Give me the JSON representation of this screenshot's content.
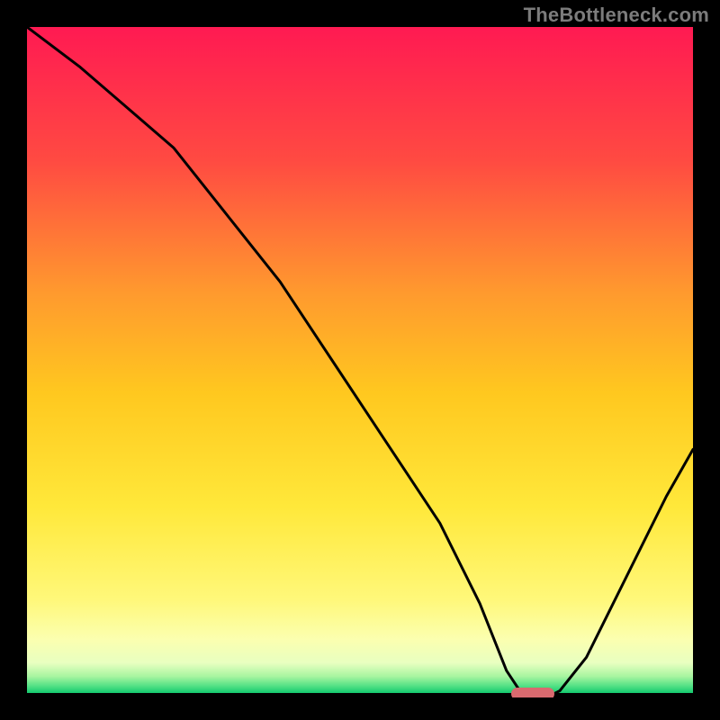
{
  "watermark": "TheBottleneck.com",
  "chart_data": {
    "type": "line",
    "title": "",
    "xlabel": "",
    "ylabel": "",
    "xlim": [
      0,
      100
    ],
    "ylim": [
      0,
      100
    ],
    "series": [
      {
        "name": "curve",
        "x": [
          0,
          8,
          22,
          30,
          38,
          46,
          54,
          62,
          68,
          72,
          74,
          76,
          78,
          80,
          84,
          88,
          92,
          96,
          100
        ],
        "y": [
          100,
          94,
          82,
          72,
          62,
          50,
          38,
          26,
          14,
          4,
          1,
          0,
          0,
          1,
          6,
          14,
          22,
          30,
          37
        ]
      }
    ],
    "marker": {
      "x": 76,
      "y": 0.5,
      "color": "#d96a6f"
    },
    "background_gradient": {
      "stops": [
        {
          "pos": 0.0,
          "color": "#ff1a52"
        },
        {
          "pos": 0.2,
          "color": "#ff4a42"
        },
        {
          "pos": 0.4,
          "color": "#ff9a2e"
        },
        {
          "pos": 0.55,
          "color": "#ffc81f"
        },
        {
          "pos": 0.72,
          "color": "#ffe83a"
        },
        {
          "pos": 0.86,
          "color": "#fff87a"
        },
        {
          "pos": 0.92,
          "color": "#fbffb0"
        },
        {
          "pos": 0.955,
          "color": "#e8ffc0"
        },
        {
          "pos": 0.975,
          "color": "#a8f5a0"
        },
        {
          "pos": 0.99,
          "color": "#4fe084"
        },
        {
          "pos": 1.0,
          "color": "#14c96e"
        }
      ]
    }
  },
  "colors": {
    "frame": "#000000",
    "curve": "#000000",
    "watermark": "#7c7c7c",
    "marker": "#d96a6f"
  }
}
